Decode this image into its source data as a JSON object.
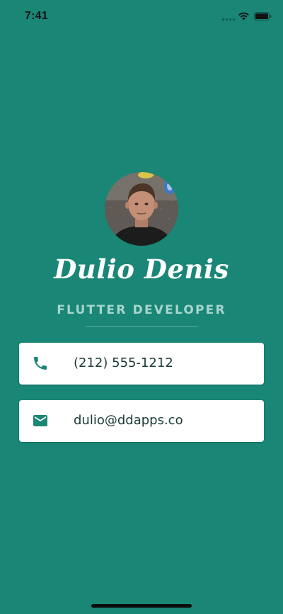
{
  "status_bar": {
    "time": "7:41",
    "icons": [
      "signal-dots",
      "wifi-icon",
      "battery-icon"
    ]
  },
  "profile": {
    "name": "Dulio Denis",
    "title": "FLUTTER DEVELOPER"
  },
  "contacts": [
    {
      "icon": "phone-icon",
      "value": "(212) 555-1212"
    },
    {
      "icon": "email-icon",
      "value": "dulio@ddapps.co"
    }
  ],
  "colors": {
    "background": "#1a8676",
    "accent": "#1a8676",
    "title_text": "#a7d6cd",
    "card": "#ffffff"
  }
}
